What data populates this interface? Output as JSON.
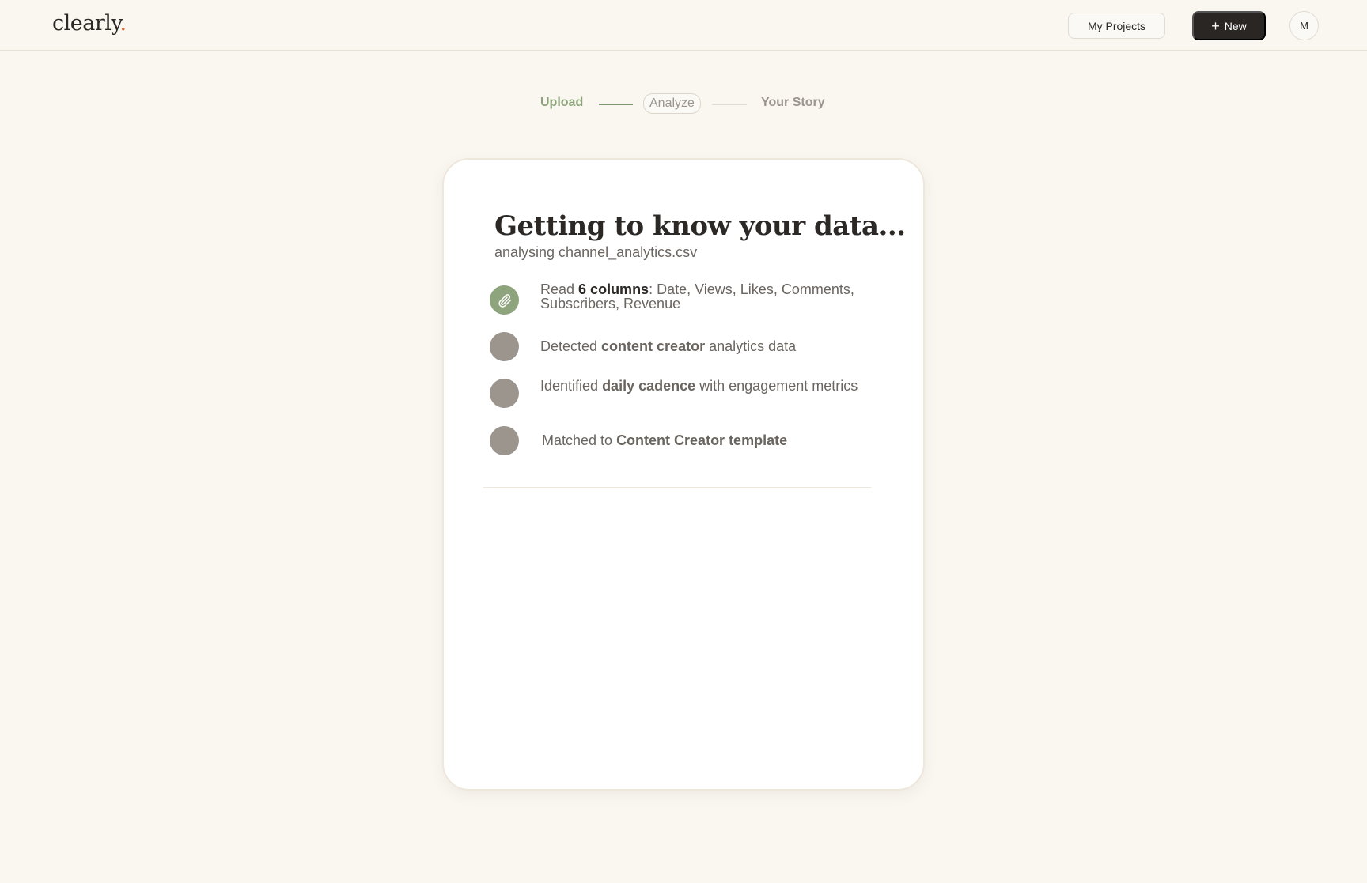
{
  "header": {
    "logo_text": "clearly",
    "logo_dot": ".",
    "my_projects_label": "My Projects",
    "new_icon": "+",
    "new_label": "New",
    "avatar_initial": "M"
  },
  "stepper": {
    "steps": [
      {
        "label": "Upload",
        "state": "complete"
      },
      {
        "label": "Analyze",
        "state": "current"
      },
      {
        "label": "Your Story",
        "state": "upcoming"
      }
    ]
  },
  "card": {
    "title": "Getting to know your data...",
    "subtitle": "analysing channel_analytics.csv",
    "items": [
      {
        "icon": "paperclip-icon",
        "state": "done",
        "pre": "Read ",
        "bold": "6 columns",
        "post": ": Date, Views, Likes, Comments, Subscribers, Revenue"
      },
      {
        "icon": "pending-circle-icon",
        "state": "pending",
        "pre": "Detected ",
        "bold": "content creator",
        "post": " analytics data"
      },
      {
        "icon": "pending-circle-icon",
        "state": "pending",
        "pre": "Identified ",
        "bold": "daily cadence",
        "post": " with engagement metrics"
      },
      {
        "icon": "pending-circle-icon",
        "state": "pending",
        "pre": "Matched to ",
        "bold": "Content Creator template",
        "post": ""
      }
    ]
  },
  "colors": {
    "background": "#faf7f1",
    "accent_green": "#8ea47d",
    "dark_button": "#2a2624",
    "logo_dot": "#d2673a",
    "pending_circle": "#9b958e"
  }
}
